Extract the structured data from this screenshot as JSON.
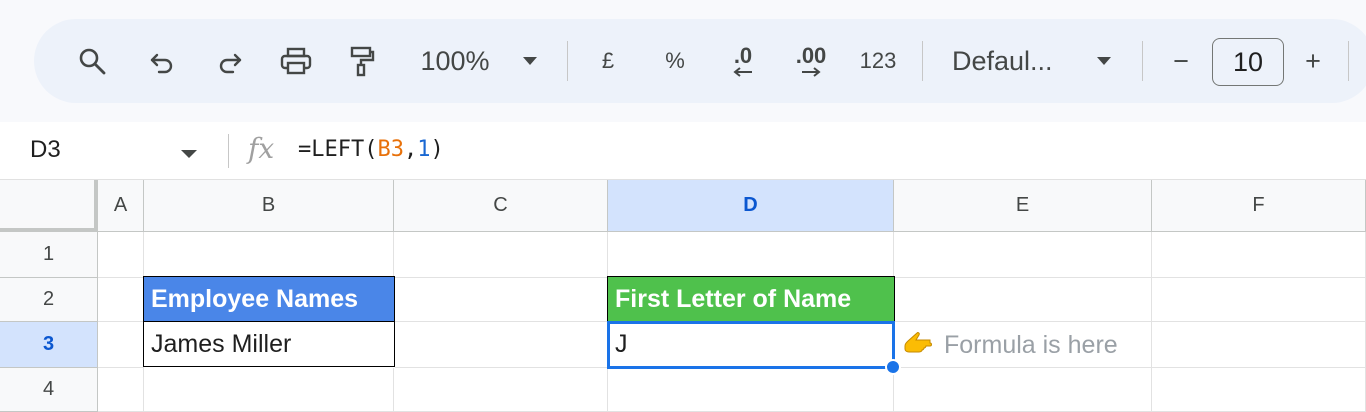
{
  "toolbar": {
    "zoom": "100%",
    "currency": "£",
    "percent": "%",
    "decrease_decimal": ".0",
    "increase_decimal": ".00",
    "number_format": "123",
    "font": "Defaul...",
    "decrease_size": "−",
    "font_size": "10",
    "increase_size": "+"
  },
  "formula_bar": {
    "name_box": "D3",
    "fx": "fx",
    "formula_prefix": "=LEFT(",
    "formula_ref": "B3",
    "formula_comma": ",",
    "formula_num": "1",
    "formula_suffix": ")"
  },
  "columns": [
    "A",
    "B",
    "C",
    "D",
    "E",
    "F"
  ],
  "rows": [
    "1",
    "2",
    "3",
    "4"
  ],
  "cells": {
    "B2": "Employee Names",
    "D2": "First Letter of Name",
    "B3": "James Miller",
    "D3": "J"
  },
  "annotation": {
    "text": "Formula is here",
    "icon": "pointing-hand-icon"
  },
  "colors": {
    "header_blue": "#4a86e8",
    "header_green": "#4fc14c",
    "selection": "#1a73e8"
  }
}
